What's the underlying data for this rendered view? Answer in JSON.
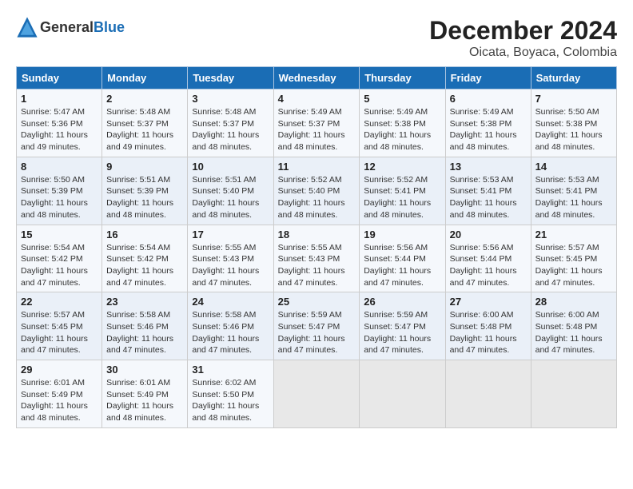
{
  "logo": {
    "general": "General",
    "blue": "Blue"
  },
  "title": "December 2024",
  "subtitle": "Oicata, Boyaca, Colombia",
  "days_header": [
    "Sunday",
    "Monday",
    "Tuesday",
    "Wednesday",
    "Thursday",
    "Friday",
    "Saturday"
  ],
  "weeks": [
    [
      {
        "day": "1",
        "sunrise": "5:47 AM",
        "sunset": "5:36 PM",
        "daylight": "11 hours and 49 minutes."
      },
      {
        "day": "2",
        "sunrise": "5:48 AM",
        "sunset": "5:37 PM",
        "daylight": "11 hours and 49 minutes."
      },
      {
        "day": "3",
        "sunrise": "5:48 AM",
        "sunset": "5:37 PM",
        "daylight": "11 hours and 48 minutes."
      },
      {
        "day": "4",
        "sunrise": "5:49 AM",
        "sunset": "5:37 PM",
        "daylight": "11 hours and 48 minutes."
      },
      {
        "day": "5",
        "sunrise": "5:49 AM",
        "sunset": "5:38 PM",
        "daylight": "11 hours and 48 minutes."
      },
      {
        "day": "6",
        "sunrise": "5:49 AM",
        "sunset": "5:38 PM",
        "daylight": "11 hours and 48 minutes."
      },
      {
        "day": "7",
        "sunrise": "5:50 AM",
        "sunset": "5:38 PM",
        "daylight": "11 hours and 48 minutes."
      }
    ],
    [
      {
        "day": "8",
        "sunrise": "5:50 AM",
        "sunset": "5:39 PM",
        "daylight": "11 hours and 48 minutes."
      },
      {
        "day": "9",
        "sunrise": "5:51 AM",
        "sunset": "5:39 PM",
        "daylight": "11 hours and 48 minutes."
      },
      {
        "day": "10",
        "sunrise": "5:51 AM",
        "sunset": "5:40 PM",
        "daylight": "11 hours and 48 minutes."
      },
      {
        "day": "11",
        "sunrise": "5:52 AM",
        "sunset": "5:40 PM",
        "daylight": "11 hours and 48 minutes."
      },
      {
        "day": "12",
        "sunrise": "5:52 AM",
        "sunset": "5:41 PM",
        "daylight": "11 hours and 48 minutes."
      },
      {
        "day": "13",
        "sunrise": "5:53 AM",
        "sunset": "5:41 PM",
        "daylight": "11 hours and 48 minutes."
      },
      {
        "day": "14",
        "sunrise": "5:53 AM",
        "sunset": "5:41 PM",
        "daylight": "11 hours and 48 minutes."
      }
    ],
    [
      {
        "day": "15",
        "sunrise": "5:54 AM",
        "sunset": "5:42 PM",
        "daylight": "11 hours and 47 minutes."
      },
      {
        "day": "16",
        "sunrise": "5:54 AM",
        "sunset": "5:42 PM",
        "daylight": "11 hours and 47 minutes."
      },
      {
        "day": "17",
        "sunrise": "5:55 AM",
        "sunset": "5:43 PM",
        "daylight": "11 hours and 47 minutes."
      },
      {
        "day": "18",
        "sunrise": "5:55 AM",
        "sunset": "5:43 PM",
        "daylight": "11 hours and 47 minutes."
      },
      {
        "day": "19",
        "sunrise": "5:56 AM",
        "sunset": "5:44 PM",
        "daylight": "11 hours and 47 minutes."
      },
      {
        "day": "20",
        "sunrise": "5:56 AM",
        "sunset": "5:44 PM",
        "daylight": "11 hours and 47 minutes."
      },
      {
        "day": "21",
        "sunrise": "5:57 AM",
        "sunset": "5:45 PM",
        "daylight": "11 hours and 47 minutes."
      }
    ],
    [
      {
        "day": "22",
        "sunrise": "5:57 AM",
        "sunset": "5:45 PM",
        "daylight": "11 hours and 47 minutes."
      },
      {
        "day": "23",
        "sunrise": "5:58 AM",
        "sunset": "5:46 PM",
        "daylight": "11 hours and 47 minutes."
      },
      {
        "day": "24",
        "sunrise": "5:58 AM",
        "sunset": "5:46 PM",
        "daylight": "11 hours and 47 minutes."
      },
      {
        "day": "25",
        "sunrise": "5:59 AM",
        "sunset": "5:47 PM",
        "daylight": "11 hours and 47 minutes."
      },
      {
        "day": "26",
        "sunrise": "5:59 AM",
        "sunset": "5:47 PM",
        "daylight": "11 hours and 47 minutes."
      },
      {
        "day": "27",
        "sunrise": "6:00 AM",
        "sunset": "5:48 PM",
        "daylight": "11 hours and 47 minutes."
      },
      {
        "day": "28",
        "sunrise": "6:00 AM",
        "sunset": "5:48 PM",
        "daylight": "11 hours and 47 minutes."
      }
    ],
    [
      {
        "day": "29",
        "sunrise": "6:01 AM",
        "sunset": "5:49 PM",
        "daylight": "11 hours and 48 minutes."
      },
      {
        "day": "30",
        "sunrise": "6:01 AM",
        "sunset": "5:49 PM",
        "daylight": "11 hours and 48 minutes."
      },
      {
        "day": "31",
        "sunrise": "6:02 AM",
        "sunset": "5:50 PM",
        "daylight": "11 hours and 48 minutes."
      },
      null,
      null,
      null,
      null
    ]
  ]
}
